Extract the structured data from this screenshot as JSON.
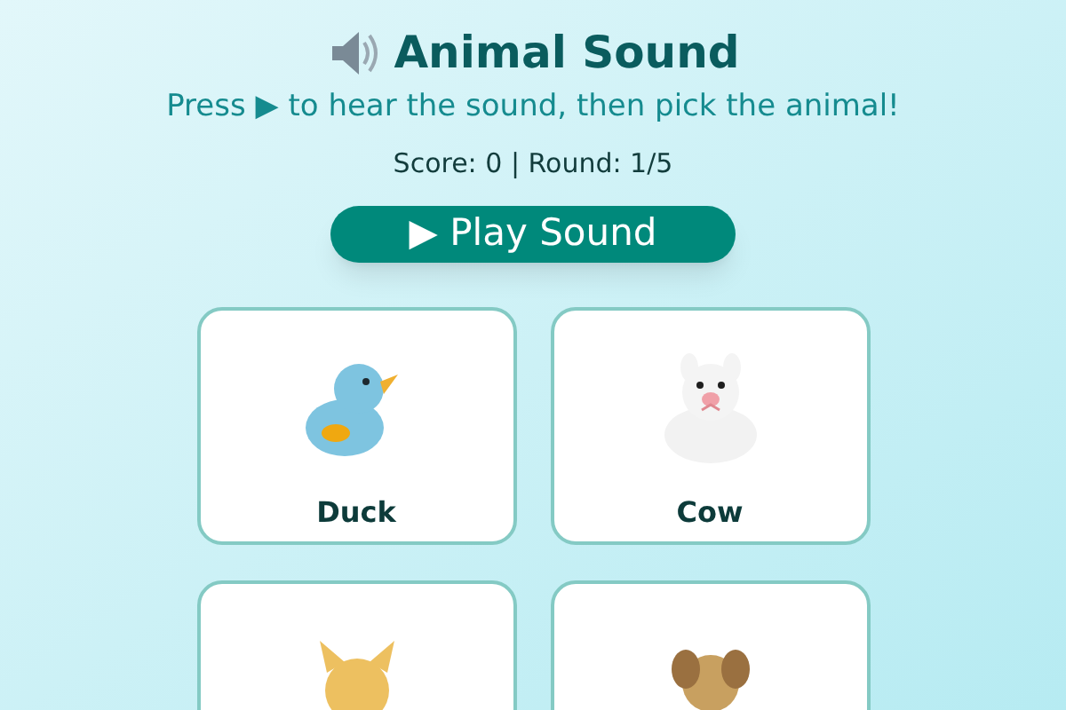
{
  "title": "Animal Sound",
  "instructions": "Press ▶ to hear the sound, then pick the animal!",
  "score_line": "Score: 0 | Round: 1/5",
  "play_button": "▶ Play Sound",
  "choices": [
    {
      "kind": "duck",
      "label": "Duck"
    },
    {
      "kind": "cow",
      "label": "Cow"
    },
    {
      "kind": "cat"
    },
    {
      "kind": "dog"
    }
  ]
}
